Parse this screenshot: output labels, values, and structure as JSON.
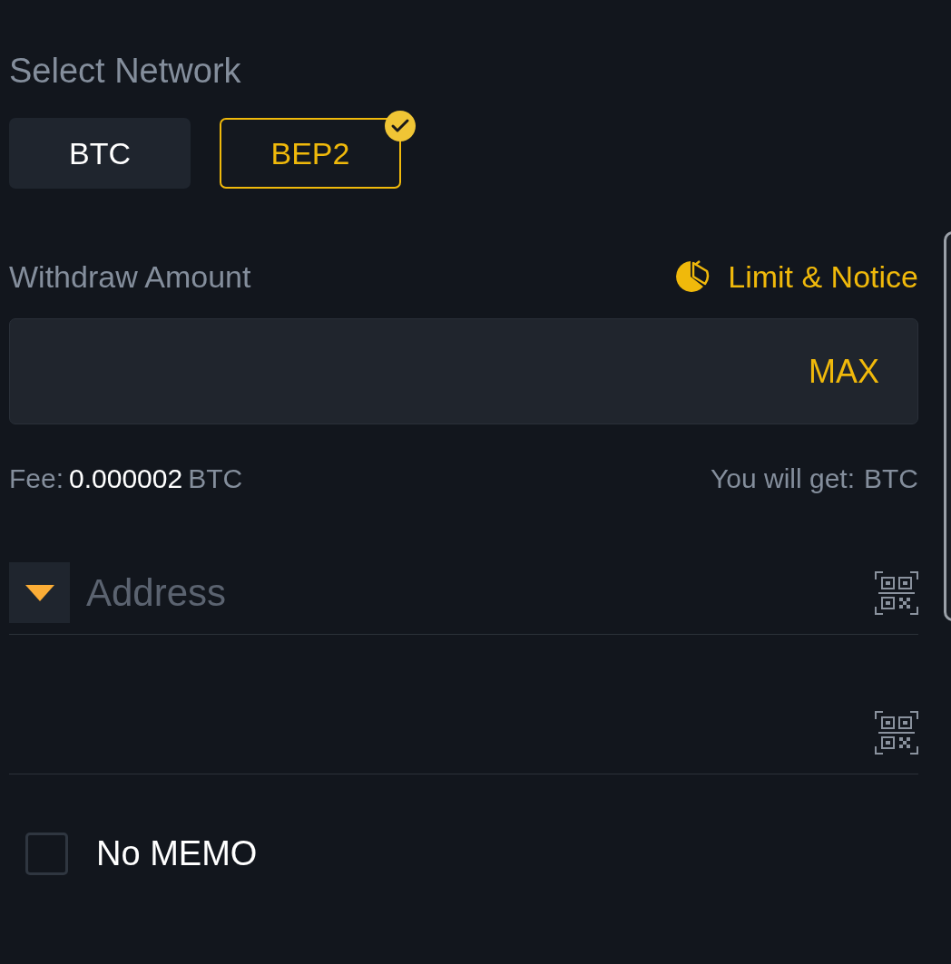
{
  "network": {
    "label": "Select Network",
    "options": [
      {
        "label": "BTC",
        "selected": false
      },
      {
        "label": "BEP2",
        "selected": true
      }
    ]
  },
  "amount": {
    "label": "Withdraw Amount",
    "limit_link": "Limit & Notice",
    "max_button": "MAX"
  },
  "fee": {
    "label": "Fee:",
    "value": "0.000002",
    "unit": "BTC"
  },
  "receive": {
    "label": "You will get:",
    "unit": "BTC"
  },
  "address": {
    "placeholder": "Address"
  },
  "no_memo": {
    "label": "No MEMO",
    "checked": false
  }
}
